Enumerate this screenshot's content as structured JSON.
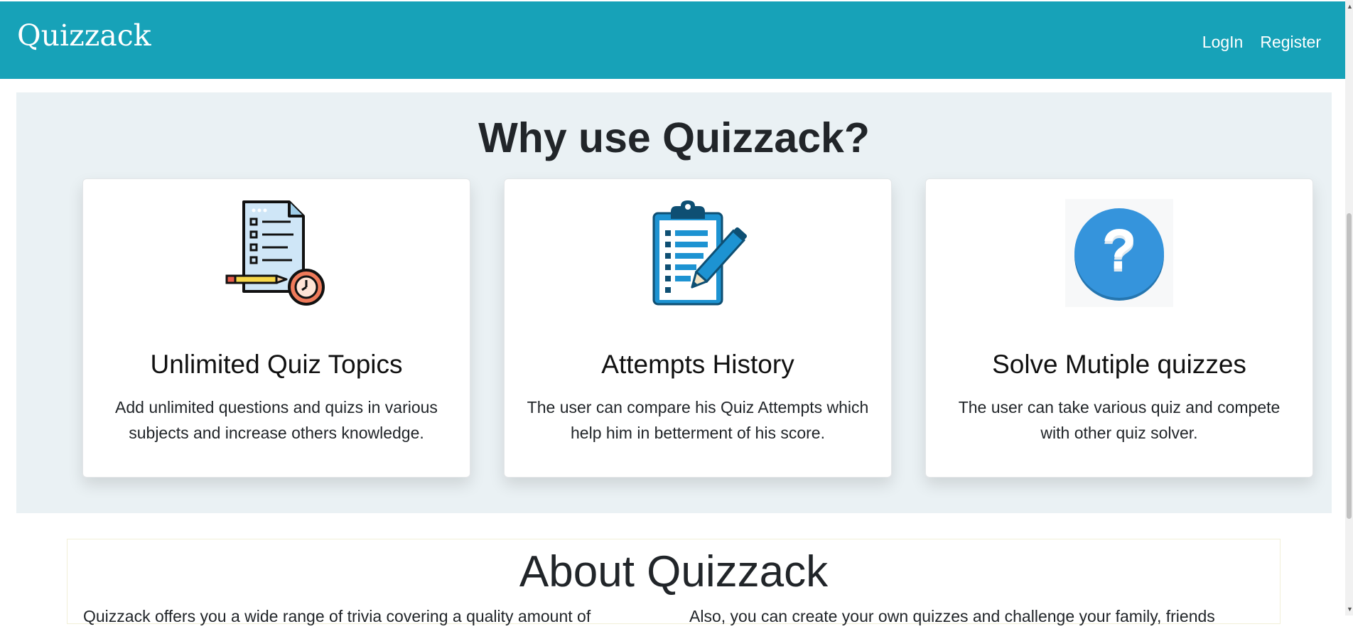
{
  "navbar": {
    "brand": "Quizzack",
    "links": [
      "LogIn",
      "Register"
    ],
    "background_color": "#17a2b8"
  },
  "why": {
    "title": "Why use Quizzack?",
    "background_color": "#eaf1f4",
    "cards": [
      {
        "icon": "quiz-document-clock-icon",
        "title": "Unlimited Quiz Topics",
        "text": "Add unlimited questions and quizs in various subjects and increase others knowledge."
      },
      {
        "icon": "clipboard-pencil-icon",
        "title": "Attempts History",
        "text": "The user can compare his Quiz Attempts which help him in betterment of his score."
      },
      {
        "icon": "question-circle-icon",
        "title": "Solve Mutiple quizzes",
        "text": "The user can take various quiz and compete with other quiz solver."
      }
    ]
  },
  "about": {
    "title": "About Quizzack",
    "text_left": "Quizzack offers you a wide range of trivia covering a quality amount of",
    "text_right": "Also, you can create your own quizzes and challenge your family, friends"
  }
}
